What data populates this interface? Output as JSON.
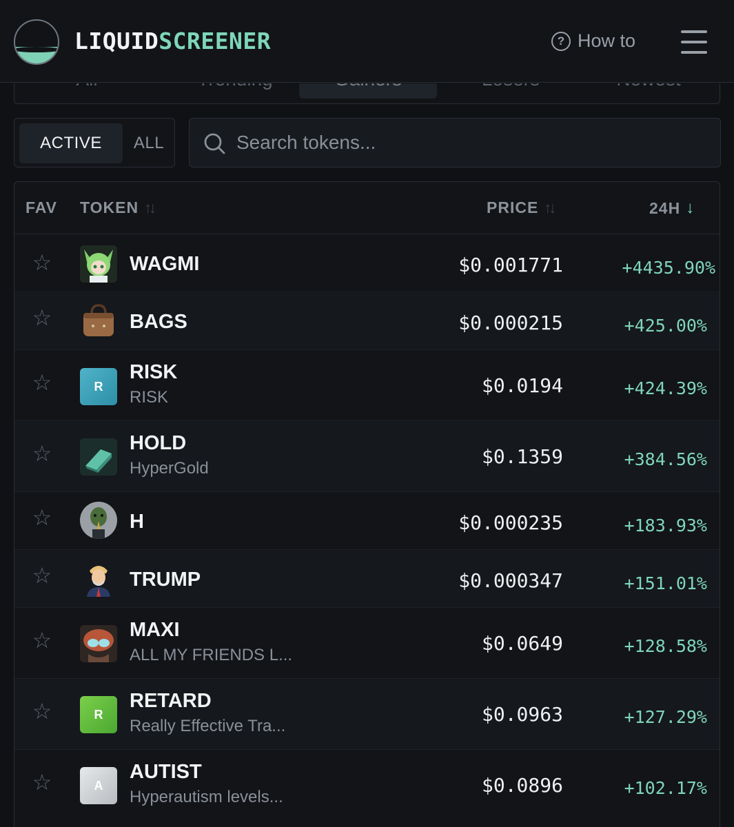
{
  "brand": {
    "part1": "LIQUID",
    "part2": "SCREENER"
  },
  "header": {
    "how_to": "How to"
  },
  "tabs": [
    "All",
    "Trending",
    "Gainers",
    "Losers",
    "Newest"
  ],
  "filter": {
    "active": "ACTIVE",
    "all": "ALL"
  },
  "search": {
    "placeholder": "Search tokens..."
  },
  "columns": {
    "fav": "FAV",
    "token": "TOKEN",
    "price": "PRICE",
    "change": "24H"
  },
  "colors": {
    "accent": "#7fd6b9",
    "background": "#0f1115"
  },
  "rows": [
    {
      "symbol": "WAGMI",
      "name": "",
      "price": "$0.001771",
      "change": "+4435.90%",
      "icon": "anime-girl-avatar-icon"
    },
    {
      "symbol": "BAGS",
      "name": "",
      "price": "$0.000215",
      "change": "+425.00%",
      "icon": "handbag-icon"
    },
    {
      "symbol": "RISK",
      "name": "RISK",
      "price": "$0.0194",
      "change": "+424.39%",
      "icon": "letter-r-icon",
      "letter": "R"
    },
    {
      "symbol": "HOLD",
      "name": "HyperGold",
      "price": "$0.1359",
      "change": "+384.56%",
      "icon": "gold-bar-icon"
    },
    {
      "symbol": "H",
      "name": "",
      "price": "$0.000235",
      "change": "+183.93%",
      "icon": "bird-mask-avatar-icon"
    },
    {
      "symbol": "TRUMP",
      "name": "",
      "price": "$0.000347",
      "change": "+151.01%",
      "icon": "cartoon-man-avatar-icon"
    },
    {
      "symbol": "MAXI",
      "name": "ALL MY FRIENDS L...",
      "price": "$0.0649",
      "change": "+128.58%",
      "icon": "helmet-avatar-icon"
    },
    {
      "symbol": "RETARD",
      "name": "Really Effective Tra...",
      "price": "$0.0963",
      "change": "+127.29%",
      "icon": "letter-r-icon",
      "letter": "R"
    },
    {
      "symbol": "AUTIST",
      "name": "Hyperautism levels...",
      "price": "$0.0896",
      "change": "+102.17%",
      "icon": "letter-a-icon",
      "letter": "A"
    }
  ]
}
